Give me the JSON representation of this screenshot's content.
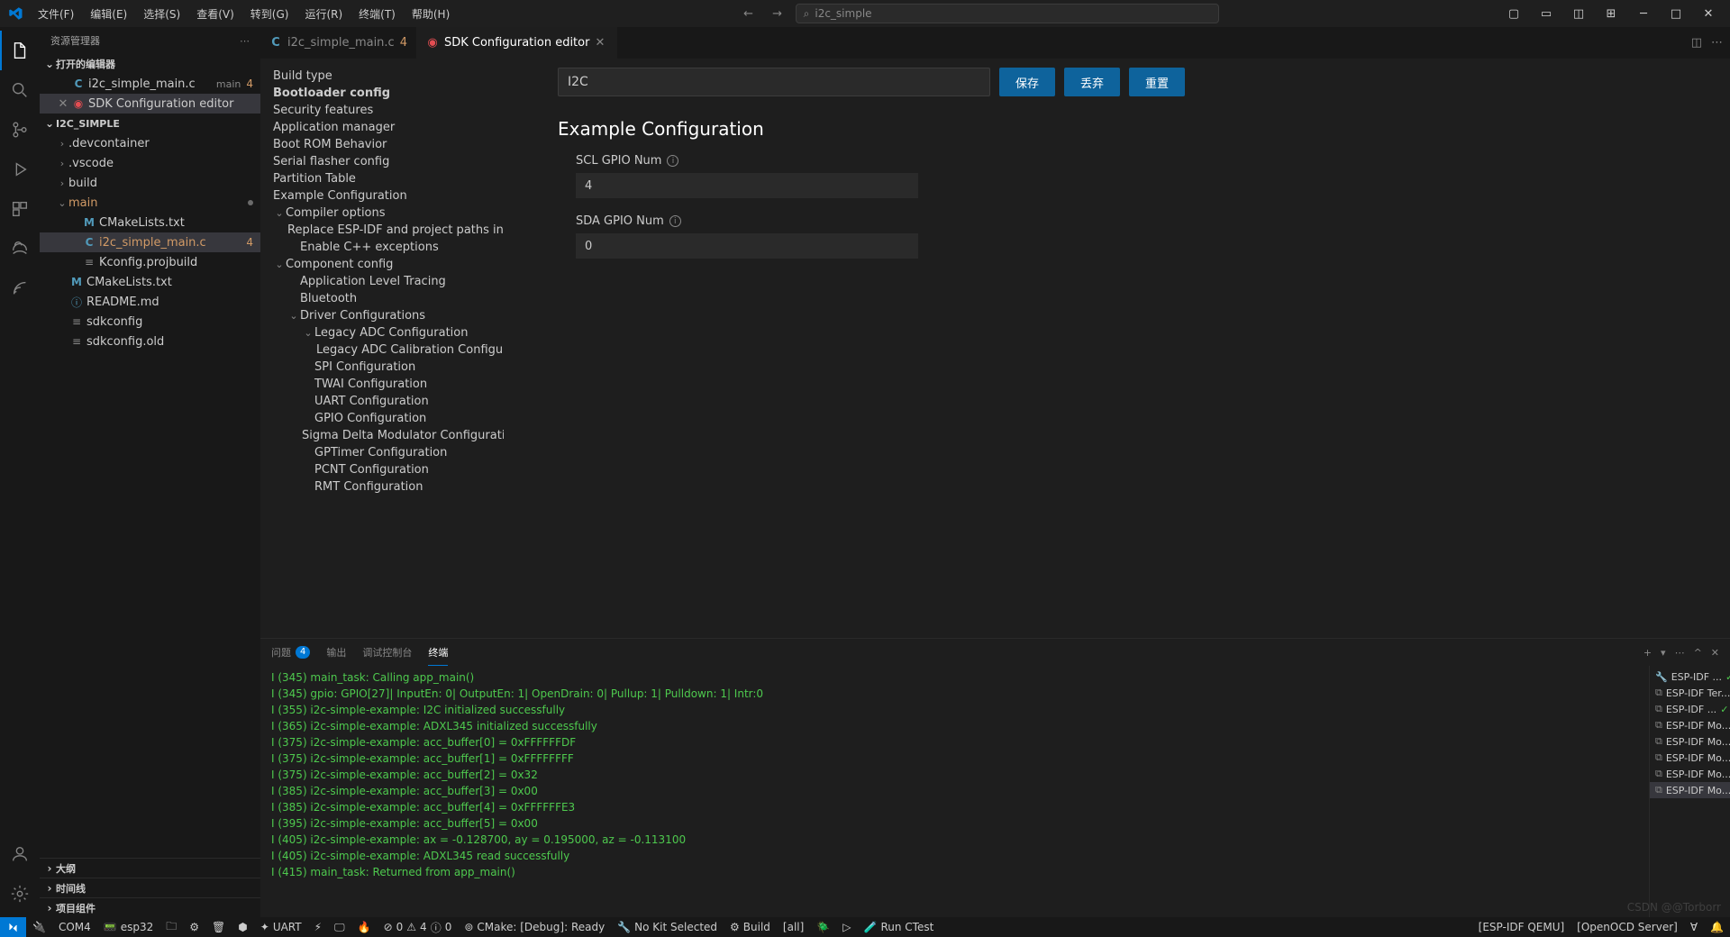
{
  "titlebar": {
    "menus": [
      "文件(F)",
      "编辑(E)",
      "选择(S)",
      "查看(V)",
      "转到(G)",
      "运行(R)",
      "终端(T)",
      "帮助(H)"
    ],
    "search_text": "i2c_simple"
  },
  "sidebar": {
    "title": "资源管理器",
    "open_editors_title": "打开的编辑器",
    "open_editors": [
      {
        "icon": "C",
        "label": "i2c_simple_main.c",
        "desc": "main",
        "badge": "4"
      },
      {
        "icon": "espr",
        "label": "SDK Configuration editor",
        "close": true,
        "active": true
      }
    ],
    "workspace_title": "I2C_SIMPLE",
    "tree": [
      {
        "indent": 1,
        "chev": "›",
        "label": ".devcontainer"
      },
      {
        "indent": 1,
        "chev": "›",
        "label": ".vscode"
      },
      {
        "indent": 1,
        "chev": "›",
        "label": "build"
      },
      {
        "indent": 1,
        "chev": "⌄",
        "label": "main",
        "mod": true,
        "dot": true
      },
      {
        "indent": 2,
        "icon": "M",
        "label": "CMakeLists.txt"
      },
      {
        "indent": 2,
        "icon": "C",
        "label": "i2c_simple_main.c",
        "badge": "4",
        "active": true,
        "mod": true
      },
      {
        "indent": 2,
        "icon": "gear",
        "label": "Kconfig.projbuild"
      },
      {
        "indent": 1,
        "icon": "M",
        "label": "CMakeLists.txt"
      },
      {
        "indent": 1,
        "icon": "info",
        "label": "README.md"
      },
      {
        "indent": 1,
        "icon": "gear",
        "label": "sdkconfig"
      },
      {
        "indent": 1,
        "icon": "gear",
        "label": "sdkconfig.old"
      }
    ],
    "collapsed_sections": [
      "大纲",
      "时间线",
      "项目组件"
    ]
  },
  "tabs": [
    {
      "icon": "C",
      "label": "i2c_simple_main.c",
      "badge": "4"
    },
    {
      "icon": "espr",
      "label": "SDK Configuration editor",
      "active": true,
      "close": true
    }
  ],
  "sdk": {
    "search_value": "I2C",
    "buttons": {
      "save": "保存",
      "discard": "丢弃",
      "reset": "重置"
    },
    "nav": [
      {
        "label": "Build type",
        "indent": 0
      },
      {
        "label": "Bootloader config",
        "indent": 0,
        "bold": true
      },
      {
        "label": "Security features",
        "indent": 0
      },
      {
        "label": "Application manager",
        "indent": 0
      },
      {
        "label": "Boot ROM Behavior",
        "indent": 0
      },
      {
        "label": "Serial flasher config",
        "indent": 0
      },
      {
        "label": "Partition Table",
        "indent": 0
      },
      {
        "label": "Example Configuration",
        "indent": 0
      },
      {
        "label": "Compiler options",
        "indent": 0,
        "chev": "⌄"
      },
      {
        "label": "Replace ESP-IDF and project paths in binaries",
        "indent": 1
      },
      {
        "label": "Enable C++ exceptions",
        "indent": 1
      },
      {
        "label": "Component config",
        "indent": 0,
        "chev": "⌄"
      },
      {
        "label": "Application Level Tracing",
        "indent": 1
      },
      {
        "label": "Bluetooth",
        "indent": 1
      },
      {
        "label": "Driver Configurations",
        "indent": 1,
        "chev": "⌄"
      },
      {
        "label": "Legacy ADC Configuration",
        "indent": 2,
        "chev": "⌄"
      },
      {
        "label": "Legacy ADC Calibration Configuration",
        "indent": 3
      },
      {
        "label": "SPI Configuration",
        "indent": 2
      },
      {
        "label": "TWAI Configuration",
        "indent": 2
      },
      {
        "label": "UART Configuration",
        "indent": 2
      },
      {
        "label": "GPIO Configuration",
        "indent": 2
      },
      {
        "label": "Sigma Delta Modulator Configuration",
        "indent": 2
      },
      {
        "label": "GPTimer Configuration",
        "indent": 2
      },
      {
        "label": "PCNT Configuration",
        "indent": 2
      },
      {
        "label": "RMT Configuration",
        "indent": 2
      }
    ],
    "heading": "Example Configuration",
    "fields": [
      {
        "label": "SCL GPIO Num",
        "value": "4"
      },
      {
        "label": "SDA GPIO Num",
        "value": "0"
      }
    ]
  },
  "panel": {
    "tabs": {
      "problems": "问题",
      "problems_count": "4",
      "output": "输出",
      "debug": "调试控制台",
      "terminal": "终端"
    },
    "terminal_lines": [
      "I (345) main_task: Calling app_main()",
      "I (345) gpio: GPIO[27]| InputEn: 0| OutputEn: 1| OpenDrain: 0| Pullup: 1| Pulldown: 1| Intr:0",
      "I (355) i2c-simple-example: I2C initialized successfully",
      "I (365) i2c-simple-example: ADXL345 initialized successfully",
      "I (375) i2c-simple-example: acc_buffer[0] = 0xFFFFFFDF",
      "",
      "I (375) i2c-simple-example: acc_buffer[1] = 0xFFFFFFFF",
      "",
      "I (375) i2c-simple-example: acc_buffer[2] = 0x32",
      "",
      "I (385) i2c-simple-example: acc_buffer[3] = 0x00",
      "",
      "I (385) i2c-simple-example: acc_buffer[4] = 0xFFFFFFE3",
      "",
      "I (395) i2c-simple-example: acc_buffer[5] = 0x00",
      "",
      "I (405) i2c-simple-example: ax = -0.128700, ay = 0.195000, az = -0.113100",
      "",
      "I (405) i2c-simple-example: ADXL345 read successfully",
      "I (415) main_task: Returned from app_main()"
    ],
    "terminals": [
      {
        "label": "ESP-IDF ...",
        "icon": "wrench",
        "check": true
      },
      {
        "label": "ESP-IDF Ter..."
      },
      {
        "label": "ESP-IDF ...",
        "check": true
      },
      {
        "label": "ESP-IDF Mo..."
      },
      {
        "label": "ESP-IDF Mo..."
      },
      {
        "label": "ESP-IDF Mo..."
      },
      {
        "label": "ESP-IDF Mo..."
      },
      {
        "label": "ESP-IDF Mo...",
        "active": true
      }
    ]
  },
  "statusbar": {
    "left": [
      "COM4",
      "esp32"
    ],
    "icons_mid": [
      "trash",
      "star",
      "uart"
    ],
    "uart_label": "UART",
    "err_warn": {
      "err": "0",
      "warn": "4",
      "ports": "0"
    },
    "cmake": "CMake: [Debug]: Ready",
    "no_kit": "No Kit Selected",
    "build": "Build",
    "all": "[all]",
    "ctest": "Run CTest",
    "right": {
      "qemu": "[ESP-IDF QEMU]",
      "openocd": "[OpenOCD Server]"
    }
  },
  "watermark": "CSDN @@Torborr"
}
